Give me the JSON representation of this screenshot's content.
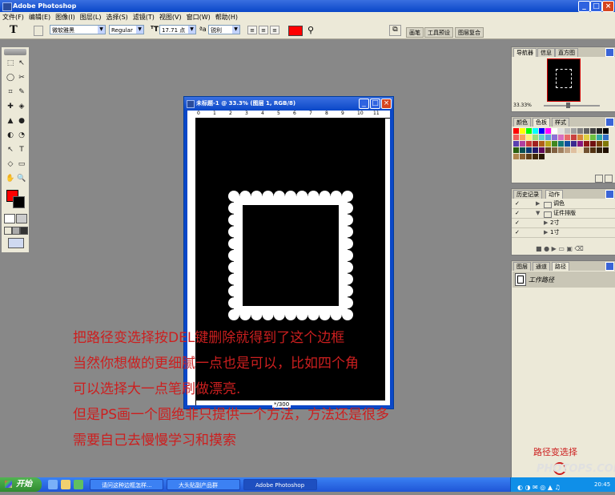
{
  "window": {
    "title": "Adobe Photoshop",
    "min": "_",
    "max": "□",
    "close": "×"
  },
  "menu": [
    "文件(F)",
    "编辑(E)",
    "图像(I)",
    "图层(L)",
    "选择(S)",
    "滤镜(T)",
    "视图(V)",
    "窗口(W)",
    "帮助(H)"
  ],
  "options": {
    "tool_glyph": "T",
    "font_family": "微软雅黑",
    "font_style": "Regular",
    "font_size": "17.71 点",
    "antialias": "锐利",
    "text_color": "#ff0000",
    "tabs": [
      "画笔",
      "工具预设",
      "图层复合"
    ]
  },
  "document": {
    "title": "未标题-1 @ 33.3% (图层 1, RGB/8)",
    "status": "*/300",
    "ruler_labels": [
      "0",
      "1",
      "2",
      "3",
      "4",
      "5",
      "6",
      "7",
      "8",
      "9",
      "10",
      "11"
    ],
    "stamp_color": "#ffffff",
    "canvas_color": "#000000"
  },
  "toolbox": {
    "foreground_color": "#ff0000",
    "background_color": "#000000",
    "tools": [
      "⬚",
      "↖",
      "◯",
      "✂",
      "⌗",
      "✎",
      "✚",
      "◈",
      "▲",
      "●",
      "◐",
      "◔",
      "↖",
      "T",
      "◇",
      "▭",
      "✋",
      "🔍"
    ]
  },
  "navigator": {
    "tabs": [
      "导航器",
      "信息",
      "直方图"
    ],
    "zoom": "33.33%"
  },
  "swatches": {
    "tabs": [
      "颜色",
      "色板",
      "样式"
    ],
    "colors": [
      "#ff0000",
      "#ffff00",
      "#00ff00",
      "#00ffff",
      "#0000ff",
      "#ff00ff",
      "#ffffff",
      "#e0e0e0",
      "#c0c0c0",
      "#a0a0a0",
      "#808080",
      "#606060",
      "#404040",
      "#202020",
      "#000000",
      "#f25f5c",
      "#f7a35c",
      "#fff27a",
      "#9ae07a",
      "#5fd0d0",
      "#5f9fe0",
      "#8c6fd8",
      "#d86fc0",
      "#e86a6a",
      "#c84040",
      "#d8883a",
      "#e0d040",
      "#6cc040",
      "#30a8a8",
      "#3070c8",
      "#5a40b0",
      "#b040a0",
      "#c83838",
      "#a02020",
      "#b06018",
      "#b8a818",
      "#408820",
      "#107878",
      "#1050a0",
      "#3a2890",
      "#881880",
      "#901818",
      "#701010",
      "#784008",
      "#807808",
      "#286010",
      "#085050",
      "#083870",
      "#201868",
      "#600858",
      "#604020",
      "#806040",
      "#a08060",
      "#c0a080",
      "#e0c0a0",
      "#f0e0c0",
      "#705030",
      "#503010",
      "#302010",
      "#201000",
      "#b08850",
      "#886030",
      "#604018",
      "#402808",
      "#281800"
    ]
  },
  "history": {
    "tabs": [
      "历史记录",
      "动作"
    ],
    "rows": [
      {
        "label": "调色",
        "type": "set"
      },
      {
        "label": "证件排版",
        "type": "set"
      },
      {
        "label": "2寸",
        "type": "action"
      },
      {
        "label": "1寸",
        "type": "action"
      }
    ]
  },
  "paths": {
    "tabs": [
      "图层",
      "通道",
      "路径"
    ],
    "item": "工作路径",
    "caption": "路径变选择"
  },
  "captions": [
    "把路径变选择按DEL键删除就得到了这个边框",
    "当然你想做的更细腻一点也是可以，比如四个角",
    "可以选择大一点笔刷做漂亮.",
    "但是PS画一个圆绝非只提供一个方法，方法还是很多",
    "需要自己去慢慢学习和摸索"
  ],
  "watermark": "PHOTOPS.COM",
  "taskbar": {
    "start": "开始",
    "tasks": [
      "请问这种边框怎样...",
      "大头贴副产品群",
      "Adobe Photoshop"
    ],
    "clock": "20:45"
  }
}
